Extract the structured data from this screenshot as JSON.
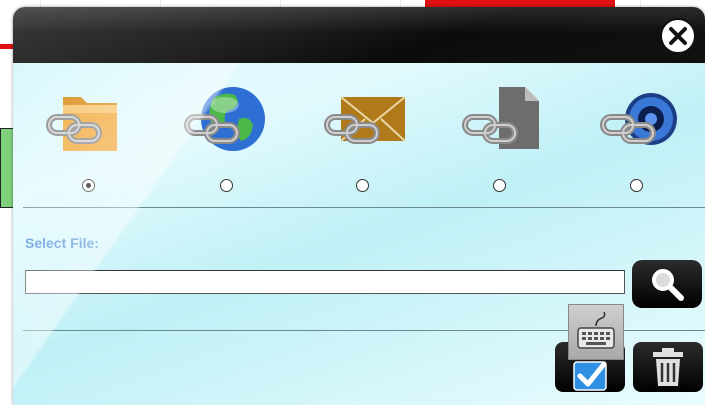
{
  "dialog": {
    "close_icon": "close-icon",
    "link_types": [
      {
        "name": "folder-link-icon",
        "selected": true
      },
      {
        "name": "web-link-icon",
        "selected": false
      },
      {
        "name": "email-link-icon",
        "selected": false
      },
      {
        "name": "file-link-icon",
        "selected": false
      },
      {
        "name": "audio-link-icon",
        "selected": false
      }
    ],
    "select_file_label": "Select File:",
    "file_input_value": "",
    "buttons": {
      "search": "search-icon",
      "keyboard": "keyboard-icon",
      "confirm": "checkmark-icon",
      "delete": "trash-icon"
    }
  },
  "colors": {
    "label": "#4a8ed6",
    "titlebar": "#111111",
    "background": "#d4f6fb"
  }
}
